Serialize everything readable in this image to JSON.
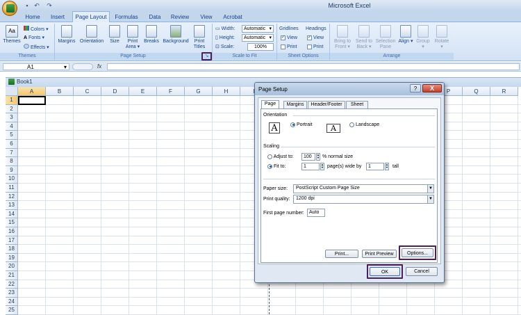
{
  "app": {
    "title": "Microsoft Excel",
    "qat": [
      "save-icon",
      "undo-icon",
      "redo-icon"
    ]
  },
  "tabs": [
    "Home",
    "Insert",
    "Page Layout",
    "Formulas",
    "Data",
    "Review",
    "View",
    "Acrobat"
  ],
  "ribbon": {
    "themes": {
      "themes_label": "Themes",
      "colors": "Colors",
      "fonts": "Fonts",
      "effects": "Effects",
      "group": "Themes"
    },
    "page_setup": {
      "margins": "Margins",
      "orientation": "Orientation",
      "size": "Size",
      "print_area_1": "Print",
      "print_area_2": "Area",
      "breaks": "Breaks",
      "background": "Background",
      "print_titles_1": "Print",
      "print_titles_2": "Titles",
      "group": "Page Setup"
    },
    "scale_to_fit": {
      "width_label": "Width:",
      "width_value": "Automatic",
      "height_label": "Height:",
      "height_value": "Automatic",
      "scale_label": "Scale:",
      "scale_value": "100%",
      "group": "Scale to Fit"
    },
    "sheet_options": {
      "gridlines": "Gridlines",
      "headings": "Headings",
      "view": "View",
      "print": "Print",
      "group": "Sheet Options"
    },
    "arrange": {
      "bring_1": "Bring to",
      "bring_2": "Front",
      "send_1": "Send to",
      "send_2": "Back",
      "selection_1": "Selection",
      "selection_2": "Pane",
      "align": "Align",
      "group_btn": "Group",
      "rotate": "Rotate",
      "group": "Arrange"
    }
  },
  "formula_bar": {
    "name_box": "A1",
    "fx": "fx",
    "value": ""
  },
  "workbook": {
    "title": "Book1"
  },
  "columns": [
    "A",
    "B",
    "C",
    "D",
    "E",
    "F",
    "G",
    "H",
    "I",
    "J",
    "K",
    "L",
    "M",
    "N",
    "O",
    "P",
    "Q",
    "R"
  ],
  "rows": [
    "1",
    "2",
    "3",
    "4",
    "5",
    "6",
    "7",
    "8",
    "9",
    "10",
    "11",
    "12",
    "13",
    "14",
    "15",
    "16",
    "17",
    "18",
    "19",
    "20",
    "21",
    "22",
    "23",
    "24",
    "25"
  ],
  "dialog": {
    "title": "Page Setup",
    "help": "?",
    "close": "X",
    "tabs": [
      "Page",
      "Margins",
      "Header/Footer",
      "Sheet"
    ],
    "orientation": {
      "label": "Orientation",
      "portrait": "Portrait",
      "landscape": "Landscape",
      "selected": "portrait"
    },
    "scaling": {
      "label": "Scaling",
      "adjust_to": "Adjust to:",
      "adjust_value": "100",
      "adjust_suffix": "% normal size",
      "fit_to": "Fit to:",
      "fit_wide": "1",
      "fit_wide_suffix": "page(s) wide by",
      "fit_tall": "1",
      "fit_tall_suffix": "tall",
      "selected": "fit"
    },
    "paper_size": {
      "label": "Paper size:",
      "value": "PostScript Custom Page Size"
    },
    "print_quality": {
      "label": "Print quality:",
      "value": "1200 dpi"
    },
    "first_page": {
      "label": "First page number:",
      "value": "Auto"
    },
    "buttons": {
      "print": "Print...",
      "preview": "Print Preview",
      "options": "Options...",
      "ok": "OK",
      "cancel": "Cancel"
    }
  }
}
